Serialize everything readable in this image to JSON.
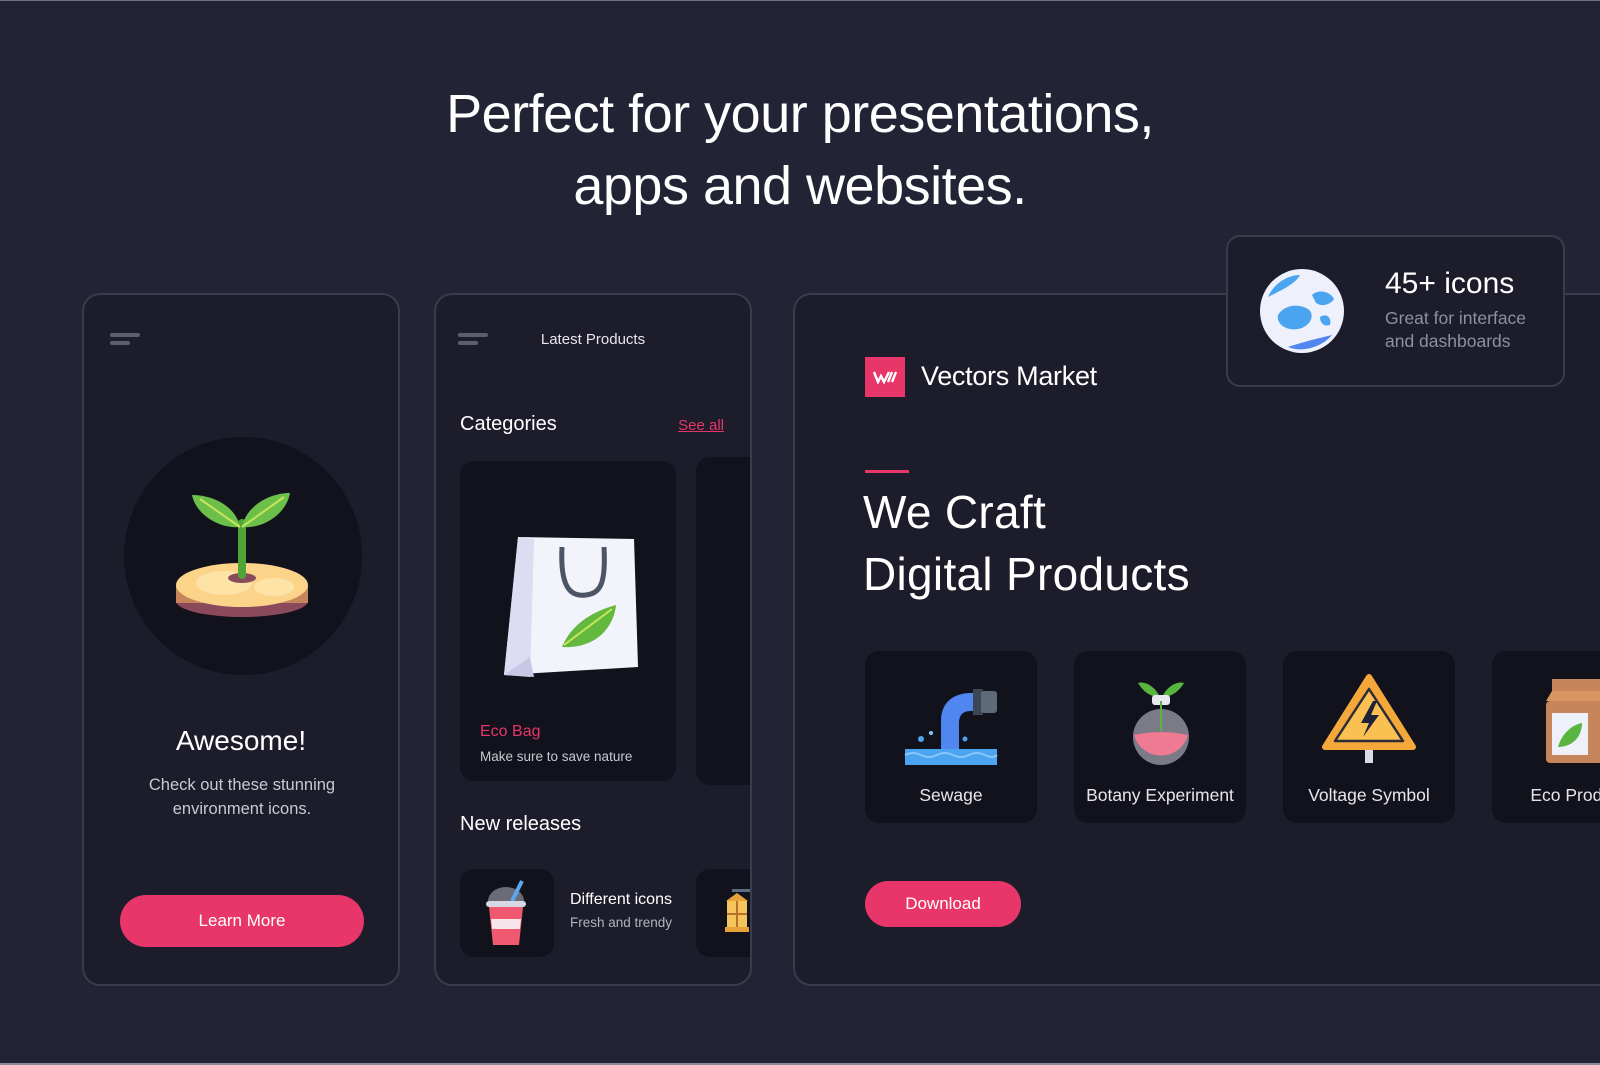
{
  "headline": {
    "line1": "Perfect for your presentations,",
    "line2": "apps and websites."
  },
  "colors": {
    "background": "#222335",
    "panel": "#1c1c2a",
    "tile": "#12121d",
    "accent": "#e8356a"
  },
  "onboarding_card": {
    "menu_icon": "hamburger-menu-icon",
    "illustration": "sprout-on-wood-slice-icon",
    "title": "Awesome!",
    "text_line1": "Check out these stunning",
    "text_line2": "environment icons.",
    "button_label": "Learn More"
  },
  "products_card": {
    "menu_icon": "hamburger-menu-icon",
    "header_title": "Latest Products",
    "categories_title": "Categories",
    "see_all_label": "See all",
    "category": {
      "icon": "eco-bag-icon",
      "name": "Eco Bag",
      "description": "Make sure to save nature"
    },
    "new_releases_title": "New releases",
    "release": {
      "icon": "drink-cup-icon",
      "title": "Different icons",
      "subtitle": "Fresh and trendy"
    },
    "release_next_icon": "lantern-icon"
  },
  "landing_card": {
    "brand_logo_text": "W",
    "brand_name": "Vectors Market",
    "hero_line1": "We Craft",
    "hero_line2": "Digital Products",
    "icons": [
      {
        "label": "Sewage",
        "icon": "sewage-pipe-icon"
      },
      {
        "label": "Botany Experiment",
        "icon": "botany-flask-icon"
      },
      {
        "label": "Voltage Symbol",
        "icon": "voltage-warning-icon"
      },
      {
        "label": "Eco Product",
        "icon": "eco-product-box-icon"
      }
    ],
    "download_label": "Download"
  },
  "stat_card": {
    "icon": "globe-icon",
    "title": "45+ icons",
    "subtitle_line1": "Great for interface",
    "subtitle_line2": "and dashboards"
  }
}
